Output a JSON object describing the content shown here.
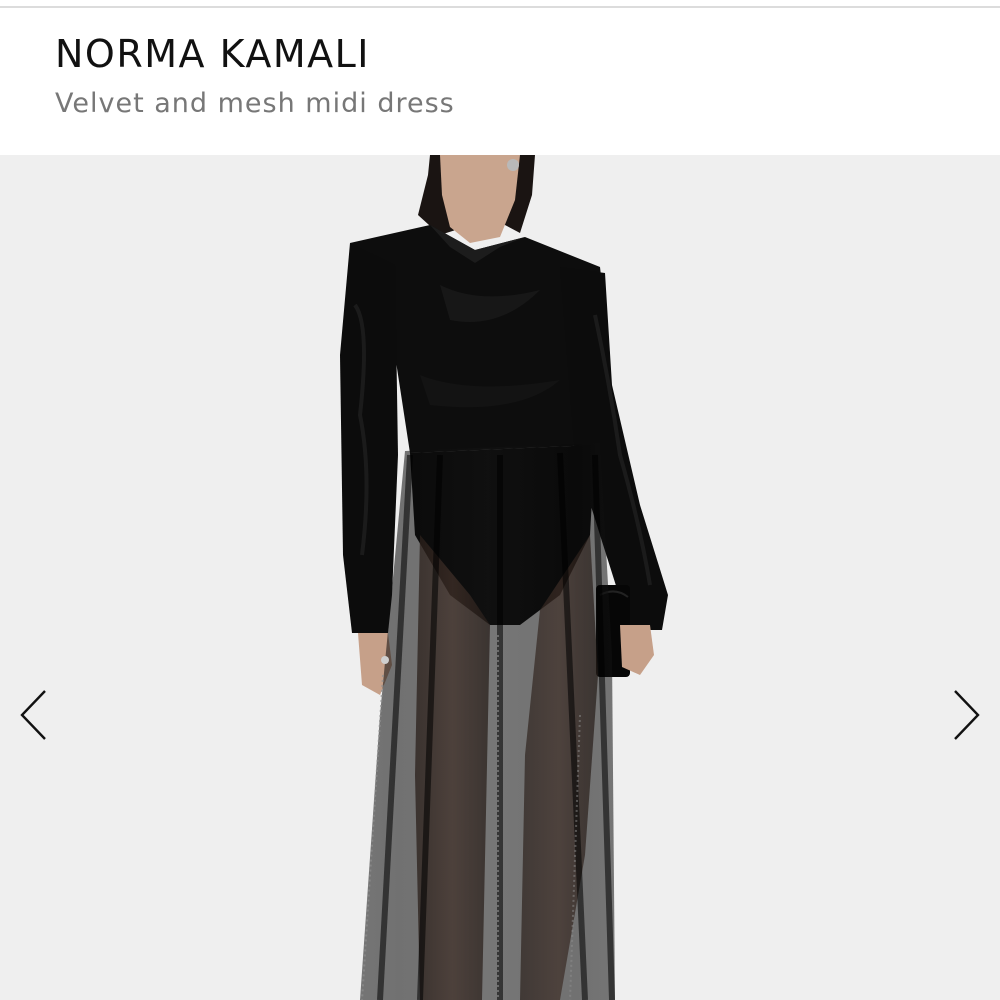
{
  "product": {
    "brand": "NORMA KAMALI",
    "name": "Velvet and mesh midi dress"
  },
  "gallery": {
    "image_description_icon": "product-photo",
    "prev_icon": "chevron-left-icon",
    "next_icon": "chevron-right-icon"
  },
  "colors": {
    "background": "#efefef",
    "brand_text": "#111111",
    "subtitle_text": "#777777",
    "dress": "#0b0b0b"
  }
}
